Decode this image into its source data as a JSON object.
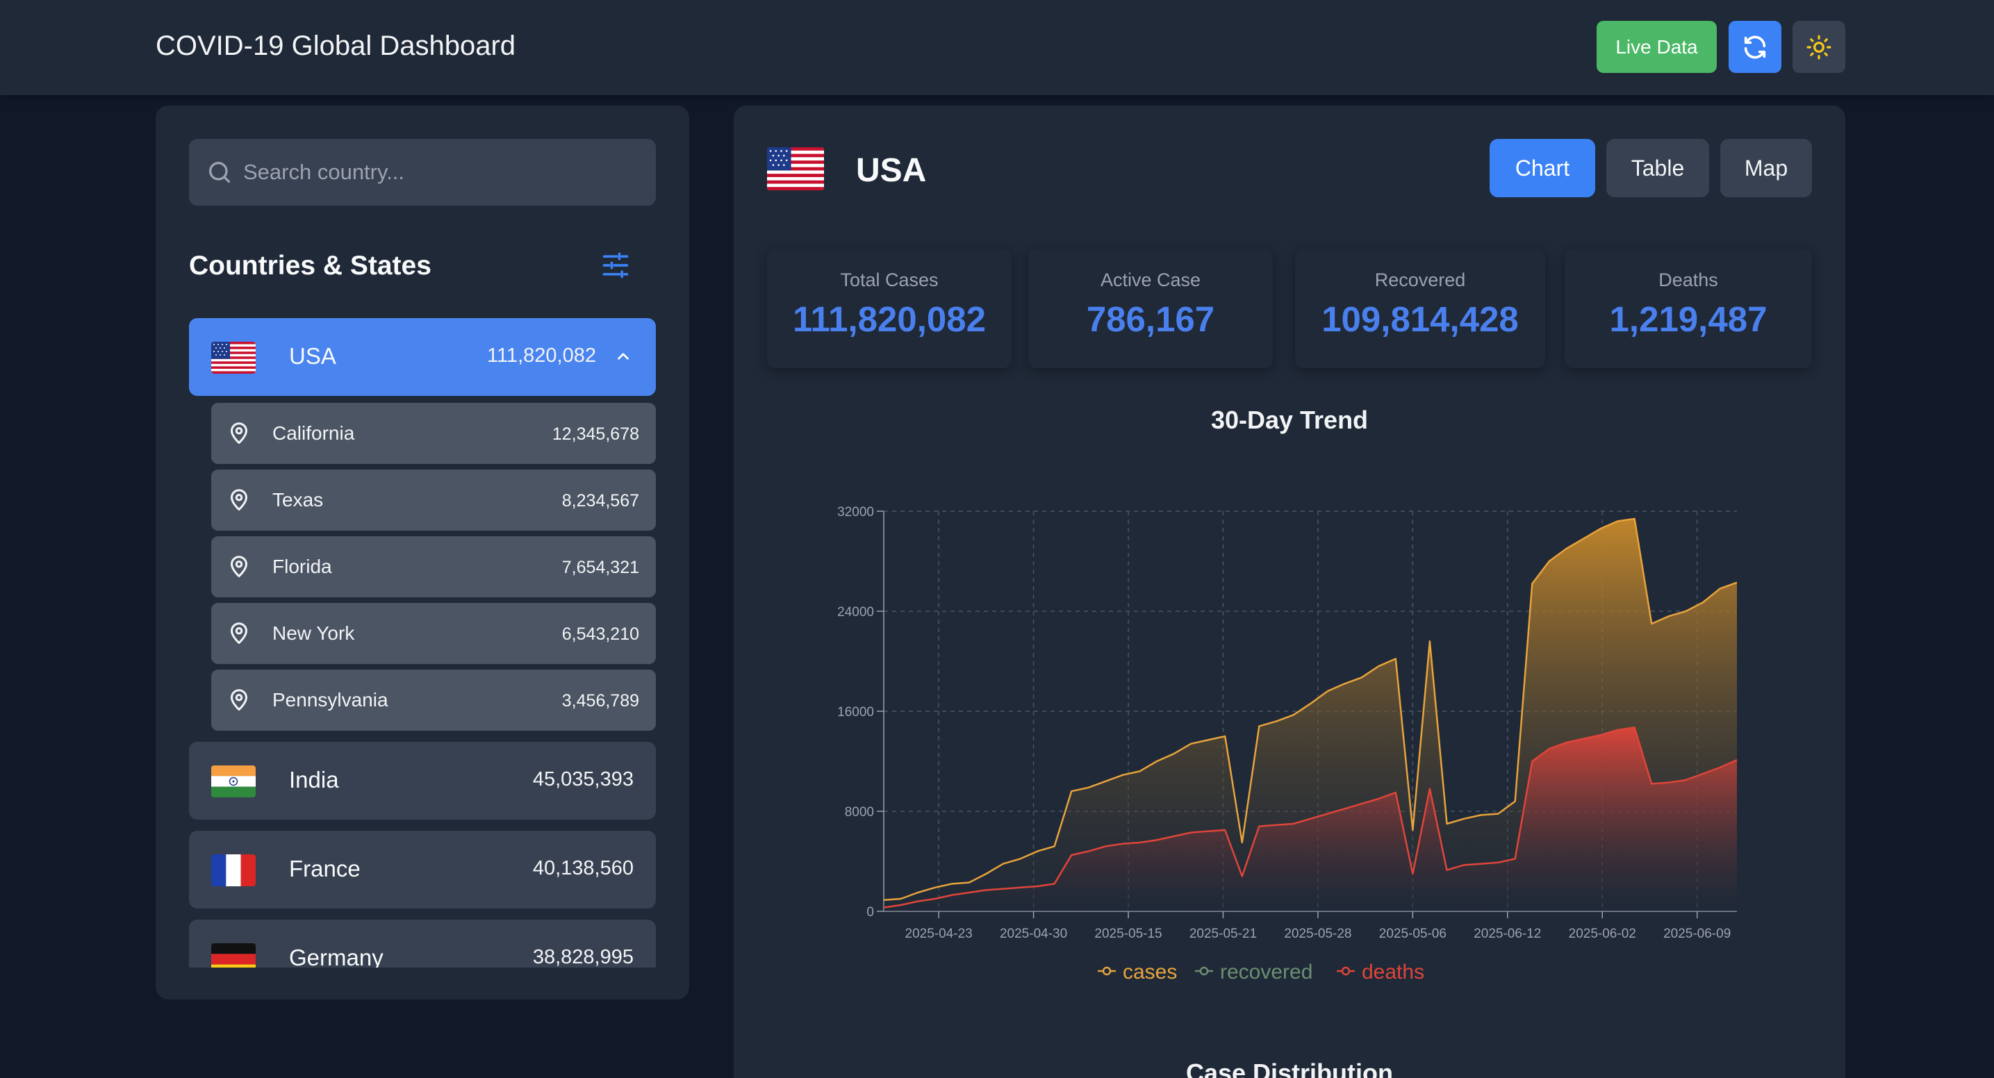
{
  "header": {
    "title": "COVID-19 Global Dashboard",
    "live_label": "Live Data",
    "refresh_icon": "refresh-icon",
    "theme_icon": "sun-icon",
    "colors": {
      "live": "#4ab866",
      "refresh": "#3b82f6",
      "sun": "#facc15"
    }
  },
  "sidebar": {
    "search_placeholder": "Search country...",
    "heading": "Countries & States",
    "countries": [
      {
        "name": "USA",
        "count": "111,820,082",
        "flag": "us",
        "expanded": true
      },
      {
        "name": "India",
        "count": "45,035,393",
        "flag": "in"
      },
      {
        "name": "France",
        "count": "40,138,560",
        "flag": "fr"
      },
      {
        "name": "Germany",
        "count": "38,828,995",
        "flag": "de"
      }
    ],
    "states": [
      {
        "name": "California",
        "count": "12,345,678"
      },
      {
        "name": "Texas",
        "count": "8,234,567"
      },
      {
        "name": "Florida",
        "count": "7,654,321"
      },
      {
        "name": "New York",
        "count": "6,543,210"
      },
      {
        "name": "Pennsylvania",
        "count": "3,456,789"
      }
    ]
  },
  "main": {
    "country": "USA",
    "tabs": [
      "Chart",
      "Table",
      "Map"
    ],
    "active_tab": "Chart",
    "stats": [
      {
        "label": "Total Cases",
        "value": "111,820,082"
      },
      {
        "label": "Active Case",
        "value": "786,167"
      },
      {
        "label": "Recovered",
        "value": "109,814,428"
      },
      {
        "label": "Deaths",
        "value": "1,219,487"
      }
    ],
    "chart_title": "30-Day Trend",
    "next_section_title": "Case Distribution"
  },
  "chart_data": {
    "type": "area",
    "title": "30-Day Trend",
    "ylim": [
      0,
      32000
    ],
    "yticks": [
      0,
      8000,
      16000,
      24000,
      32000
    ],
    "xtick_labels": [
      "2025-04-23",
      "2025-04-30",
      "2025-05-15",
      "2025-05-21",
      "2025-05-28",
      "2025-05-06",
      "2025-06-12",
      "2025-06-02",
      "2025-06-09"
    ],
    "grid": true,
    "legend_position": "bottom",
    "series": [
      {
        "name": "cases",
        "color": "#e8a33d",
        "values": [
          900,
          1000,
          1500,
          1900,
          2200,
          2300,
          3000,
          3800,
          4200,
          4800,
          5200,
          9600,
          9900,
          10400,
          10900,
          11200,
          12000,
          12600,
          13400,
          13700,
          14000,
          5500,
          14800,
          15200,
          15700,
          16600,
          17600,
          18200,
          18700,
          19600,
          20200,
          6500,
          21600,
          7000,
          7400,
          7700,
          7800,
          8800,
          26200,
          28000,
          29000,
          29800,
          30600,
          31200,
          31400,
          23000,
          23600,
          24000,
          24700,
          25800,
          26300
        ]
      },
      {
        "name": "recovered",
        "color": "#6b8f71",
        "values": []
      },
      {
        "name": "deaths",
        "color": "#e0453a",
        "values": [
          300,
          500,
          800,
          1000,
          1300,
          1500,
          1700,
          1800,
          1900,
          2000,
          2200,
          4500,
          4800,
          5200,
          5400,
          5500,
          5700,
          6000,
          6300,
          6400,
          6500,
          2800,
          6800,
          6900,
          7000,
          7400,
          7800,
          8200,
          8600,
          9000,
          9500,
          3000,
          9800,
          3300,
          3700,
          3800,
          3900,
          4200,
          12000,
          13000,
          13500,
          13800,
          14100,
          14500,
          14700,
          10200,
          10300,
          10500,
          11000,
          11500,
          12100
        ]
      }
    ]
  }
}
